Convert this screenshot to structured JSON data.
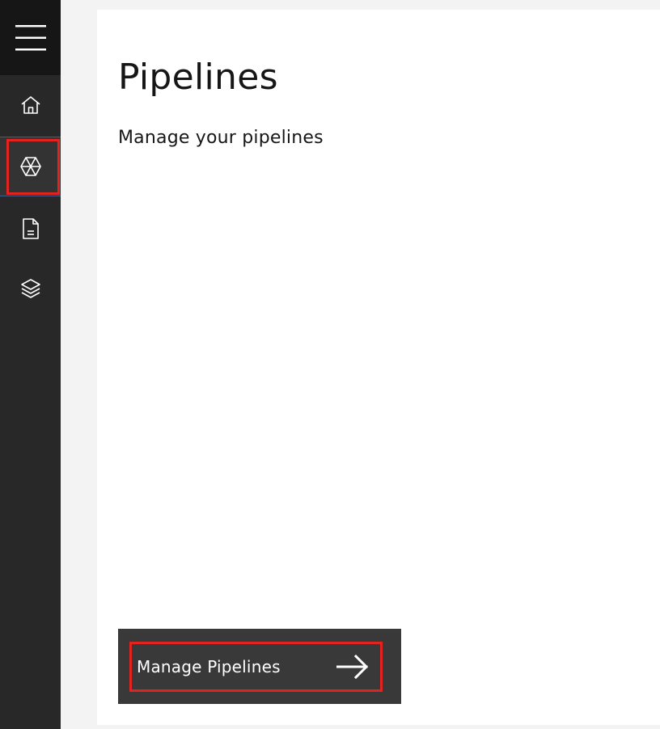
{
  "nav": {
    "menu_icon": "hamburger-menu-icon",
    "items": [
      {
        "icon": "home-icon"
      },
      {
        "icon": "pipelines-icon",
        "active": true
      },
      {
        "icon": "document-icon"
      },
      {
        "icon": "layers-icon"
      }
    ]
  },
  "page": {
    "title": "Pipelines",
    "subtitle": "Manage your pipelines"
  },
  "action": {
    "label": "Manage Pipelines",
    "icon": "arrow-right-icon"
  },
  "colors": {
    "rail_bg": "#282828",
    "menu_bg": "#161616",
    "highlight": "#e3231f",
    "tile_bg": "#393939",
    "page_bg": "#f3f3f3"
  }
}
